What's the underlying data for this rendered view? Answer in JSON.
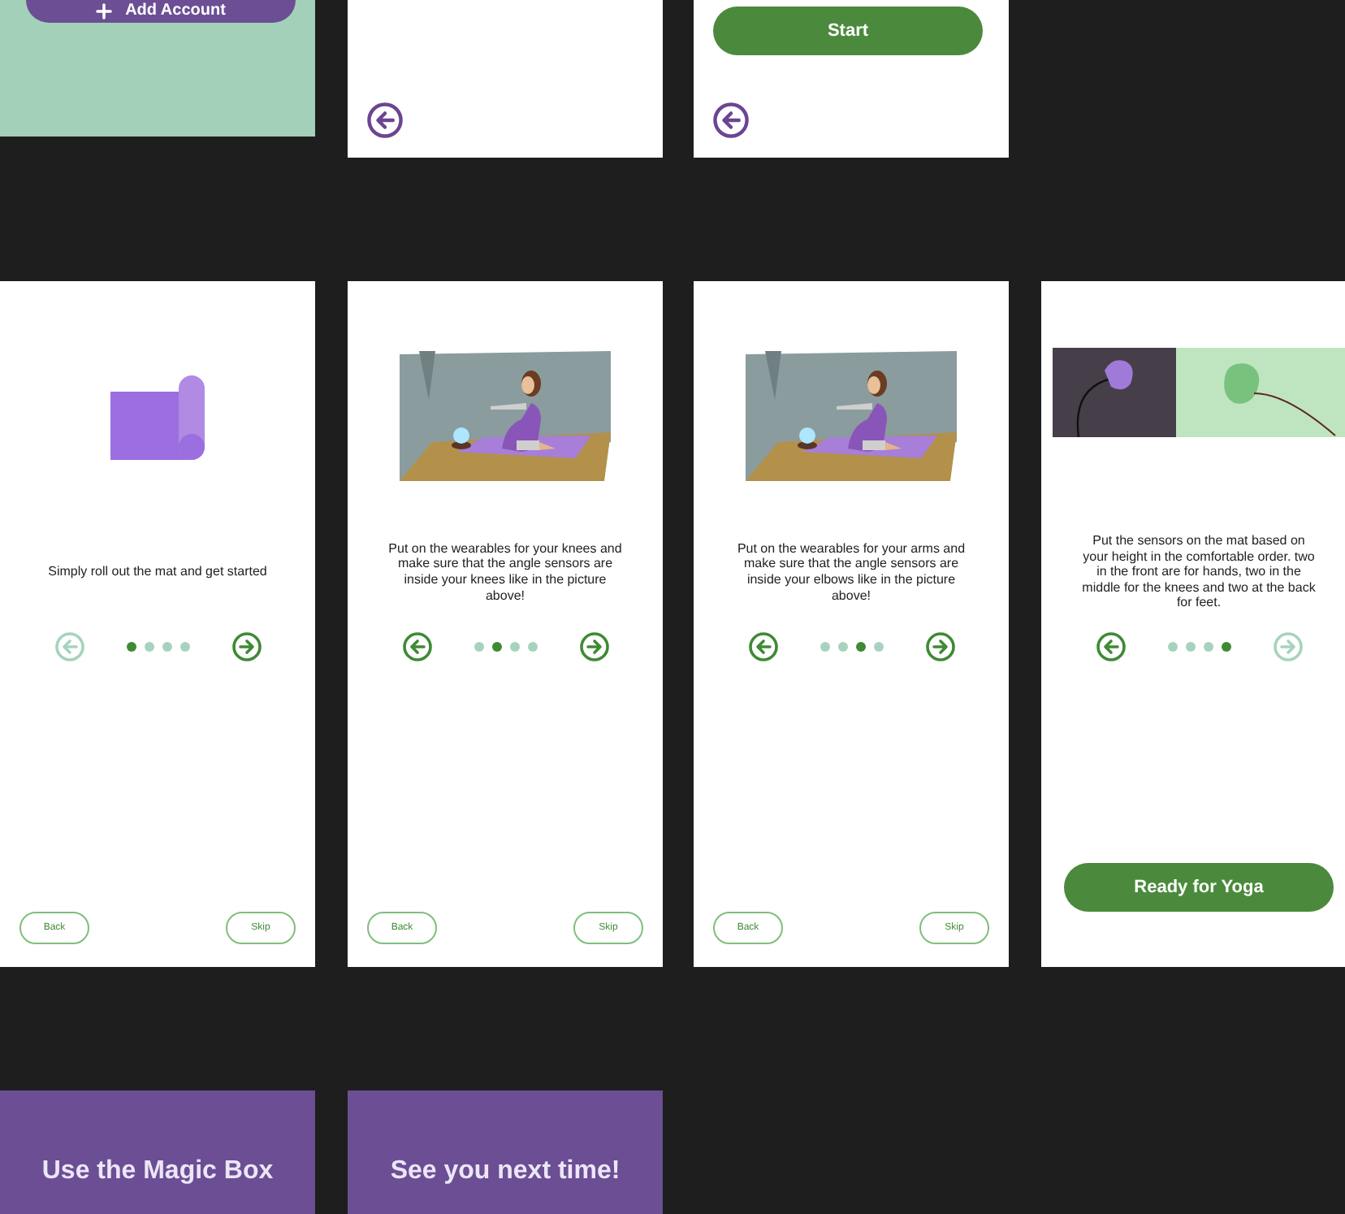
{
  "top_frames": [
    {
      "kind": "account",
      "button": {
        "label": "Add Account"
      },
      "back_button": false
    },
    {
      "kind": "blank",
      "back_button": true
    },
    {
      "kind": "start",
      "button": {
        "label": "Start"
      },
      "back_button": true
    }
  ],
  "onboarding": [
    {
      "kind": "mat",
      "text": "Simply roll out the mat and get started",
      "prev_enabled": false,
      "next_enabled": true,
      "dots": [
        {
          "selected": true
        },
        {
          "selected": false
        },
        {
          "selected": false
        },
        {
          "selected": false
        }
      ],
      "footer": {
        "kind": "pair",
        "back": "Back",
        "skip": "Skip"
      }
    },
    {
      "kind": "room",
      "text": "Put on the wearables for your knees and make sure that the angle sensors are inside your knees like in the picture above!",
      "prev_enabled": true,
      "next_enabled": true,
      "dots": [
        {
          "selected": false
        },
        {
          "selected": true
        },
        {
          "selected": false
        },
        {
          "selected": false
        }
      ],
      "footer": {
        "kind": "pair",
        "back": "Back",
        "skip": "Skip"
      }
    },
    {
      "kind": "room",
      "text": "Put on the wearables for your arms and make sure that the angle sensors are inside your elbows like in the picture above!",
      "prev_enabled": true,
      "next_enabled": true,
      "dots": [
        {
          "selected": false
        },
        {
          "selected": false
        },
        {
          "selected": true
        },
        {
          "selected": false
        }
      ],
      "footer": {
        "kind": "pair",
        "back": "Back",
        "skip": "Skip"
      }
    },
    {
      "kind": "photo",
      "text": "Put the sensors on the mat based on your height in the comfortable order. two in the front are for hands, two in the middle for the knees and two at the back for feet.",
      "prev_enabled": true,
      "next_enabled": false,
      "dots": [
        {
          "selected": false
        },
        {
          "selected": false
        },
        {
          "selected": false
        },
        {
          "selected": true
        }
      ],
      "footer": {
        "kind": "primary",
        "label": "Ready for Yoga"
      }
    }
  ],
  "end_frames": [
    {
      "title": "Use the Magic Box"
    },
    {
      "title": "See you next time!"
    }
  ]
}
